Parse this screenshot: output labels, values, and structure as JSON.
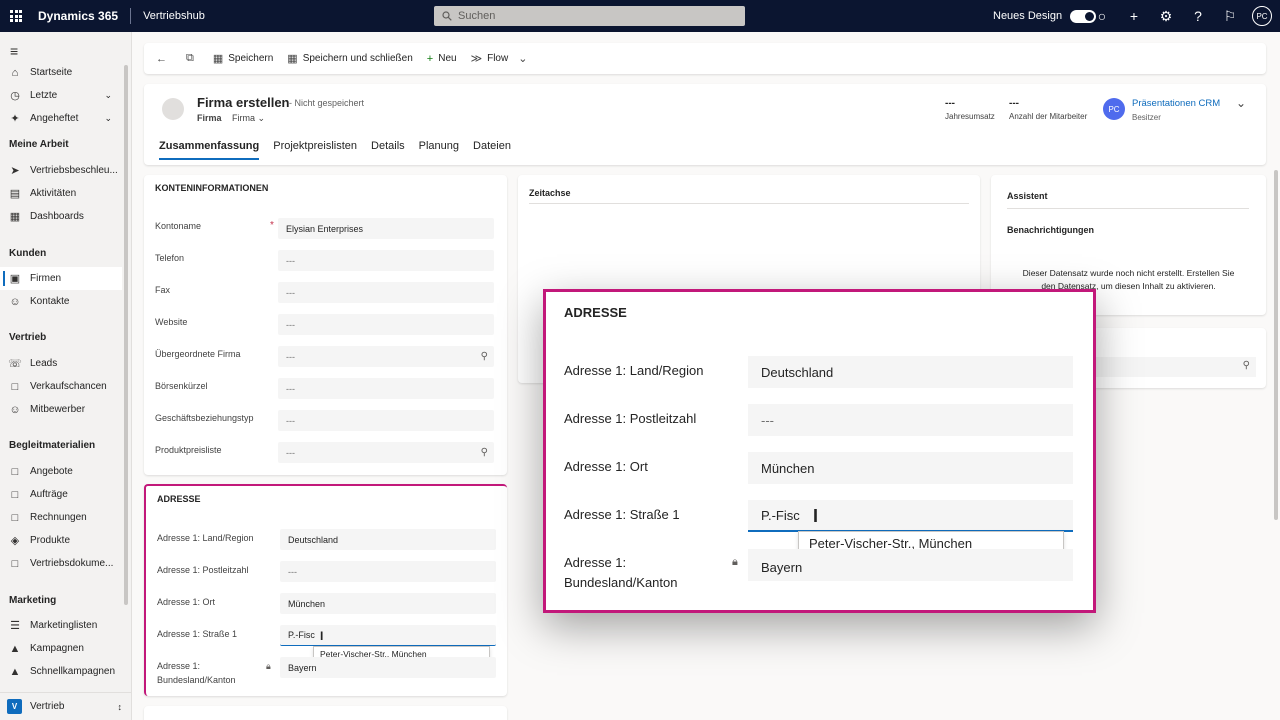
{
  "topbar": {
    "brand": "Dynamics 365",
    "hub": "Vertriebshub",
    "search_placeholder": "Suchen",
    "new_design": "Neues Design",
    "user_initials": "PC"
  },
  "sidebar": {
    "items_top": [
      {
        "label": "Startseite",
        "icon": "home-icon"
      },
      {
        "label": "Letzte",
        "icon": "clock-icon",
        "chevron": true
      },
      {
        "label": "Angeheftet",
        "icon": "pin-icon",
        "chevron": true
      }
    ],
    "groups": {
      "my_work": "Meine Arbeit",
      "customers": "Kunden",
      "sales": "Vertrieb",
      "collateral": "Begleitmaterialien",
      "marketing": "Marketing"
    },
    "my_work": [
      "Vertriebsbeschleu...",
      "Aktivitäten",
      "Dashboards"
    ],
    "customers": [
      "Firmen",
      "Kontakte"
    ],
    "sales": [
      "Leads",
      "Verkaufschancen",
      "Mitbewerber"
    ],
    "collateral": [
      "Angebote",
      "Aufträge",
      "Rechnungen",
      "Produkte",
      "Vertriebsdokume..."
    ],
    "marketing": [
      "Marketinglisten",
      "Kampagnen",
      "Schnellkampagnen"
    ],
    "area": {
      "badge": "V",
      "label": "Vertrieb"
    }
  },
  "commands": {
    "save": "Speichern",
    "save_close": "Speichern und schließen",
    "new": "Neu",
    "flow": "Flow"
  },
  "header": {
    "title": "Firma erstellen",
    "unsaved": "- Nicht gespeichert",
    "entity": "Firma",
    "form": "Firma",
    "revenue_value": "---",
    "revenue_label": "Jahresumsatz",
    "employees_value": "---",
    "employees_label": "Anzahl der Mitarbeiter",
    "owner_initials": "PC",
    "owner_name": "Präsentationen CRM",
    "owner_role": "Besitzer",
    "tabs": [
      "Zusammenfassung",
      "Projektpreislisten",
      "Details",
      "Planung",
      "Dateien"
    ]
  },
  "account_info": {
    "title": "KONTENINFORMATIONEN",
    "fields": [
      {
        "label": "Kontoname",
        "value": "Elysian Enterprises"
      },
      {
        "label": "Telefon",
        "value": "---"
      },
      {
        "label": "Fax",
        "value": "---"
      },
      {
        "label": "Website",
        "value": "---"
      },
      {
        "label": "Übergeordnete Firma",
        "value": "---"
      },
      {
        "label": "Börsenkürzel",
        "value": "---"
      },
      {
        "label": "Geschäftsbeziehungstyp",
        "value": "---"
      },
      {
        "label": "Produktpreisliste",
        "value": "---"
      }
    ]
  },
  "address": {
    "title": "ADRESSE",
    "fields": [
      {
        "label": "Adresse 1: Land/Region",
        "value": "Deutschland"
      },
      {
        "label": "Adresse 1: Postleitzahl",
        "value": "---"
      },
      {
        "label": "Adresse 1: Ort",
        "value": "München"
      },
      {
        "label": "Adresse 1: Straße 1",
        "value": "P.-Fisc"
      },
      {
        "label_line1": "Adresse 1:",
        "label_line2": "Bundesland/Kanton",
        "value": "Bayern"
      }
    ],
    "suggestion": "Peter-Vischer-Str., München"
  },
  "timeline": {
    "title": "Zeitachse"
  },
  "assistant": {
    "title": "Assistent",
    "notifications": "Benachrichtigungen",
    "message_line1": "Dieser Datensatz wurde noch nicht erstellt. Erstellen Sie",
    "message_line2": "den Datensatz, um diesen Inhalt zu aktivieren."
  },
  "colors": {
    "topbar": "#0b1530",
    "accent": "#0f6cbd",
    "highlight": "#c2187a",
    "required": "#c4314b"
  }
}
